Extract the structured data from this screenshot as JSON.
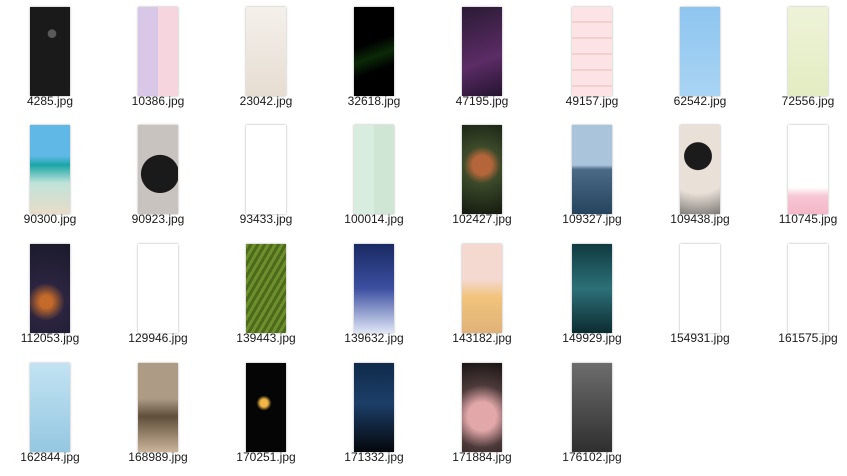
{
  "files": [
    {
      "name": "4285.jpg"
    },
    {
      "name": "10386.jpg"
    },
    {
      "name": "23042.jpg"
    },
    {
      "name": "32618.jpg"
    },
    {
      "name": "47195.jpg"
    },
    {
      "name": "49157.jpg"
    },
    {
      "name": "62542.jpg"
    },
    {
      "name": "72556.jpg"
    },
    {
      "name": "90300.jpg"
    },
    {
      "name": "90923.jpg"
    },
    {
      "name": "93433.jpg"
    },
    {
      "name": "100014.jpg"
    },
    {
      "name": "102427.jpg"
    },
    {
      "name": "109327.jpg"
    },
    {
      "name": "109438.jpg"
    },
    {
      "name": "110745.jpg"
    },
    {
      "name": "112053.jpg"
    },
    {
      "name": "129946.jpg"
    },
    {
      "name": "139443.jpg"
    },
    {
      "name": "139632.jpg"
    },
    {
      "name": "143182.jpg"
    },
    {
      "name": "149929.jpg"
    },
    {
      "name": "154931.jpg"
    },
    {
      "name": "161575.jpg"
    },
    {
      "name": "162844.jpg"
    },
    {
      "name": "168989.jpg"
    },
    {
      "name": "170251.jpg"
    },
    {
      "name": "171332.jpg"
    },
    {
      "name": "171884.jpg"
    },
    {
      "name": "176102.jpg"
    }
  ]
}
